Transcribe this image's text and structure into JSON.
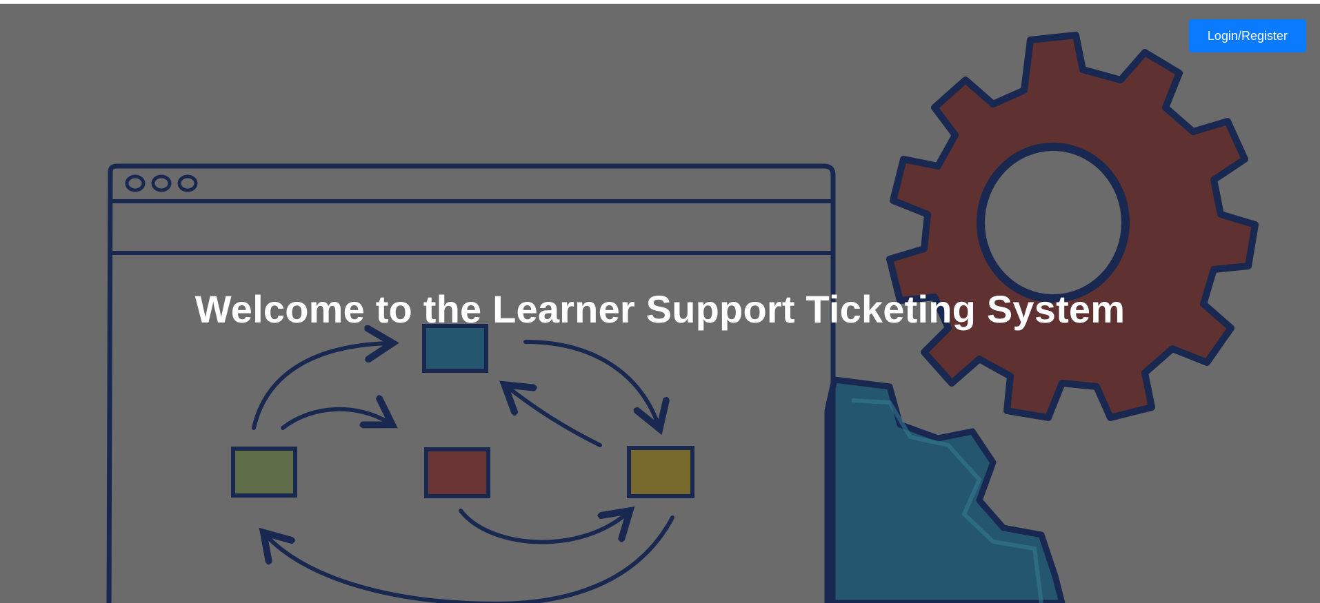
{
  "header": {
    "login_label": "Login/Register"
  },
  "hero": {
    "title": "Welcome to the Learner Support Ticketing System"
  },
  "colors": {
    "overlay": "#6b6b6b",
    "button": "#0a7bff",
    "line": "#0d1f4d",
    "gear_red": "#5e2a2a",
    "gear_blue": "#1b5570",
    "box_green": "#5d6d43",
    "box_red": "#6b2e2e",
    "box_yellow": "#7a6a24"
  },
  "icons": {
    "illustration": "workflow-gears-illustration",
    "window_dots": "window-control-dots-icon",
    "gear_red": "gear-icon",
    "gear_blue": "gear-icon"
  }
}
